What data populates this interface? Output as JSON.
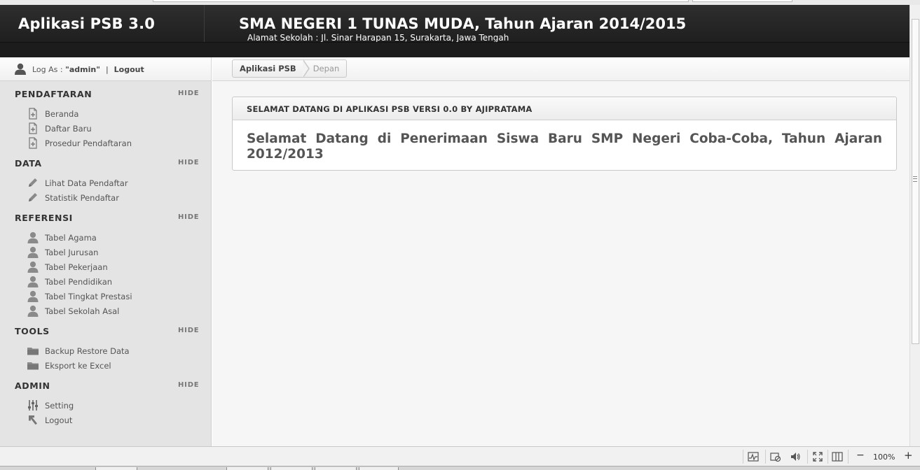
{
  "app": {
    "brand": "Aplikasi PSB 3.0",
    "school_title": "SMA NEGERI 1 TUNAS MUDA, Tahun Ajaran 2014/2015",
    "school_address": "Alamat Sekolah : Jl. Sinar Harapan 15, Surakarta, Jawa Tengah"
  },
  "user": {
    "log_as_prefix": "Log As : ",
    "username": "\"admin\"",
    "separator": "|",
    "logout": "Logout"
  },
  "sidebar": {
    "sections": [
      {
        "title": "PENDAFTARAN",
        "hide": "HIDE",
        "items": [
          {
            "label": "Beranda",
            "icon": "document-add-icon"
          },
          {
            "label": "Daftar Baru",
            "icon": "document-add-icon"
          },
          {
            "label": "Prosedur Pendaftaran",
            "icon": "document-add-icon"
          }
        ]
      },
      {
        "title": "DATA",
        "hide": "HIDE",
        "items": [
          {
            "label": "Lihat Data Pendaftar",
            "icon": "pencil-icon"
          },
          {
            "label": "Statistik Pendaftar",
            "icon": "pencil-icon"
          }
        ]
      },
      {
        "title": "REFERENSI",
        "hide": "HIDE",
        "items": [
          {
            "label": "Tabel Agama",
            "icon": "user-icon"
          },
          {
            "label": "Tabel Jurusan",
            "icon": "user-icon"
          },
          {
            "label": "Tabel Pekerjaan",
            "icon": "user-icon"
          },
          {
            "label": "Tabel Pendidikan",
            "icon": "user-icon"
          },
          {
            "label": "Tabel Tingkat Prestasi",
            "icon": "user-icon"
          },
          {
            "label": "Tabel Sekolah Asal",
            "icon": "user-icon"
          }
        ]
      },
      {
        "title": "TOOLS",
        "hide": "HIDE",
        "items": [
          {
            "label": "Backup Restore Data",
            "icon": "folder-icon"
          },
          {
            "label": "Eksport ke Excel",
            "icon": "folder-icon"
          }
        ]
      },
      {
        "title": "ADMIN",
        "hide": "HIDE",
        "items": [
          {
            "label": "Setting",
            "icon": "sliders-icon"
          },
          {
            "label": "Logout",
            "icon": "return-arrow-icon"
          }
        ]
      }
    ]
  },
  "breadcrumb": {
    "items": [
      "Aplikasi PSB",
      "Depan"
    ]
  },
  "panel": {
    "title": "SELAMAT DATANG DI APLIKASI PSB VERSI 0.0 BY AJIPRATAMA",
    "body": "Selamat Datang di Penerimaan Siswa Baru SMP Negeri Coba-Coba, Tahun Ajaran 2012/2013"
  },
  "statusbar": {
    "zoom": "100%",
    "zoom_minus": "−",
    "zoom_plus": "+"
  },
  "colors": {
    "header_bg": "#1f1f1f",
    "sidebar_bg": "#e4e4e4",
    "content_bg": "#f6f6f6"
  }
}
